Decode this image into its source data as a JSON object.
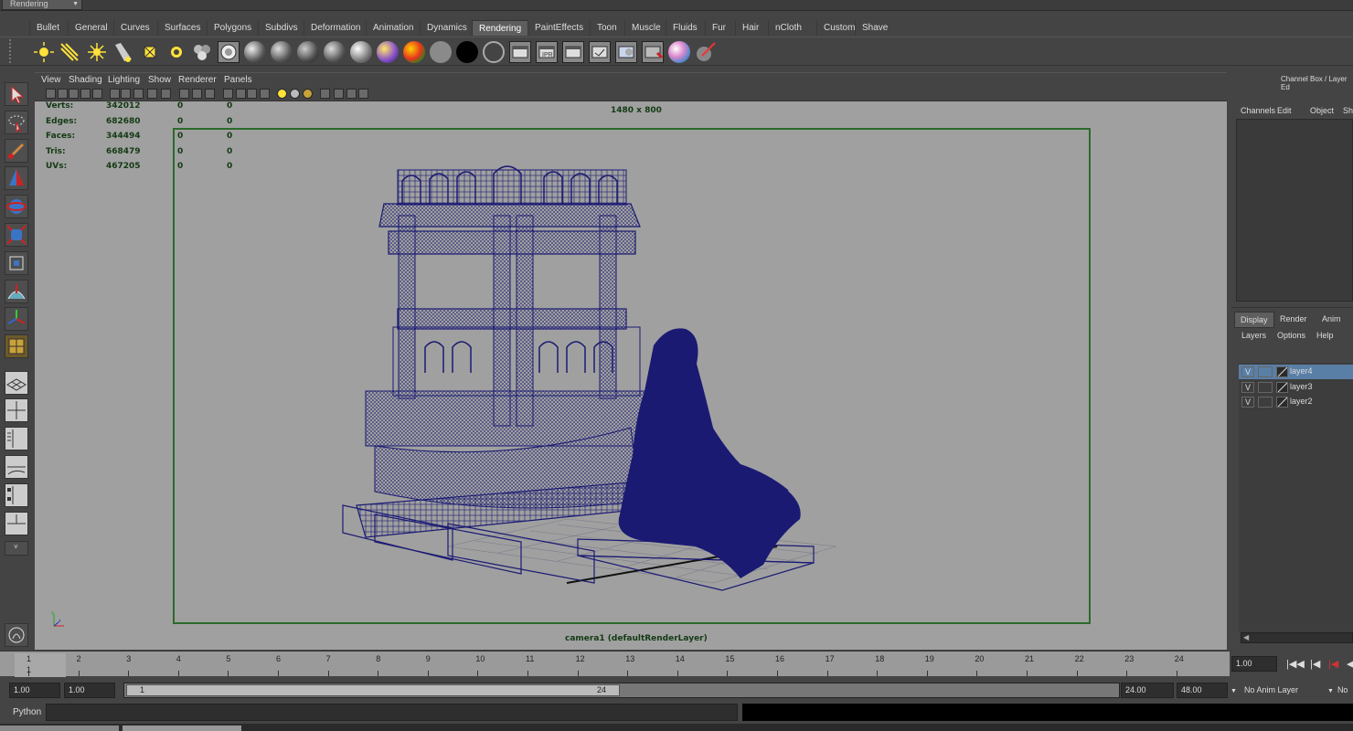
{
  "menu_set": "Rendering",
  "shelf_tabs": [
    "Bullet",
    "General",
    "Curves",
    "Surfaces",
    "Polygons",
    "Subdivs",
    "Deformation",
    "Animation",
    "Dynamics",
    "Rendering",
    "PaintEffects",
    "Toon",
    "Muscle",
    "Fluids",
    "Fur",
    "Hair",
    "nCloth",
    "Custom",
    "Shave"
  ],
  "active_shelf_tab": "Rendering",
  "viewport_menu": [
    "View",
    "Shading",
    "Lighting",
    "Show",
    "Renderer",
    "Panels"
  ],
  "hud": {
    "rows": [
      {
        "label": "Verts:",
        "v1": "342012",
        "v2": "0",
        "v3": "0"
      },
      {
        "label": "Edges:",
        "v1": "682680",
        "v2": "0",
        "v3": "0"
      },
      {
        "label": "Faces:",
        "v1": "344494",
        "v2": "0",
        "v3": "0"
      },
      {
        "label": "Tris:",
        "v1": "668479",
        "v2": "0",
        "v3": "0"
      },
      {
        "label": "UVs:",
        "v1": "467205",
        "v2": "0",
        "v3": "0"
      }
    ],
    "resolution": "1480 x 800",
    "camera": "camera1 (defaultRenderLayer)"
  },
  "channel_box": {
    "title": "Channel Box / Layer Ed",
    "menu": [
      "Channels",
      "Edit",
      "Object",
      "Sh"
    ]
  },
  "layer_editor": {
    "tabs": [
      "Display",
      "Render",
      "Anim"
    ],
    "menu": [
      "Layers",
      "Options",
      "Help"
    ],
    "layers": [
      {
        "v": "V",
        "name": "layer4",
        "selected": true
      },
      {
        "v": "V",
        "name": "layer3",
        "selected": false
      },
      {
        "v": "V",
        "name": "layer2",
        "selected": false
      }
    ]
  },
  "timeline": {
    "ticks": [
      "1",
      "2",
      "3",
      "4",
      "5",
      "6",
      "7",
      "8",
      "9",
      "10",
      "11",
      "12",
      "13",
      "14",
      "15",
      "16",
      "17",
      "18",
      "19",
      "20",
      "21",
      "22",
      "23",
      "24"
    ],
    "current_frame": "1",
    "current_time_field": "1.00"
  },
  "range": {
    "start": "1.00",
    "anim_start": "1.00",
    "slider_start": "1",
    "slider_end": "24",
    "end": "24.00",
    "anim_end": "48.00",
    "anim_layer": "No Anim Layer",
    "char_set": "No"
  },
  "command_line": {
    "language": "Python"
  },
  "colors": {
    "wireframe": "#1a1a73",
    "viewport_bg": "#a0a0a0",
    "resolution_gate": "#2b6a2b",
    "hud_text": "#133a13",
    "layer_selected": "#5a7fa6",
    "active_tab": "#5e5e5e"
  }
}
